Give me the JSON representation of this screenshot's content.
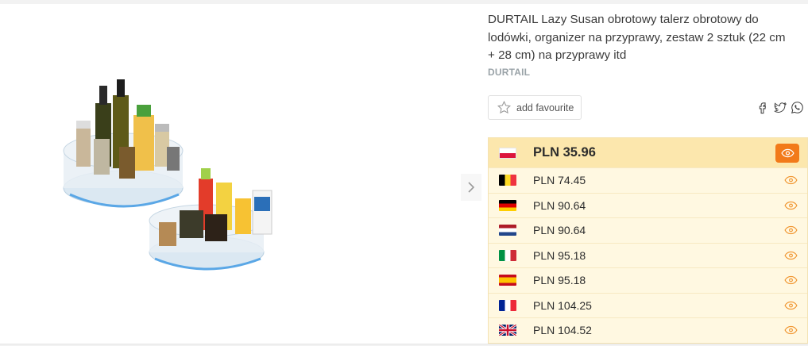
{
  "product": {
    "title": "DURTAIL Lazy Susan obrotowy talerz obrotowy do lodówki, organizer na przyprawy, zestaw 2 sztuk (22 cm + 28 cm) na przyprawy itd",
    "brand": "DURTAIL"
  },
  "favourite": {
    "label": "add favourite"
  },
  "share": {
    "icons": [
      "facebook-icon",
      "twitter-icon",
      "whatsapp-icon"
    ]
  },
  "colors": {
    "accent": "#f27a1a",
    "best_row": "#fce7ad",
    "rows_bg": "#fff8e1"
  },
  "prices": [
    {
      "country": "poland",
      "price": "PLN 35.96",
      "best": true
    },
    {
      "country": "belgium",
      "price": "PLN 74.45"
    },
    {
      "country": "germany",
      "price": "PLN 90.64"
    },
    {
      "country": "netherlands",
      "price": "PLN 90.64"
    },
    {
      "country": "italy",
      "price": "PLN 95.18"
    },
    {
      "country": "spain",
      "price": "PLN 95.18"
    },
    {
      "country": "france",
      "price": "PLN 104.25"
    },
    {
      "country": "united-kingdom",
      "price": "PLN 104.52"
    }
  ]
}
